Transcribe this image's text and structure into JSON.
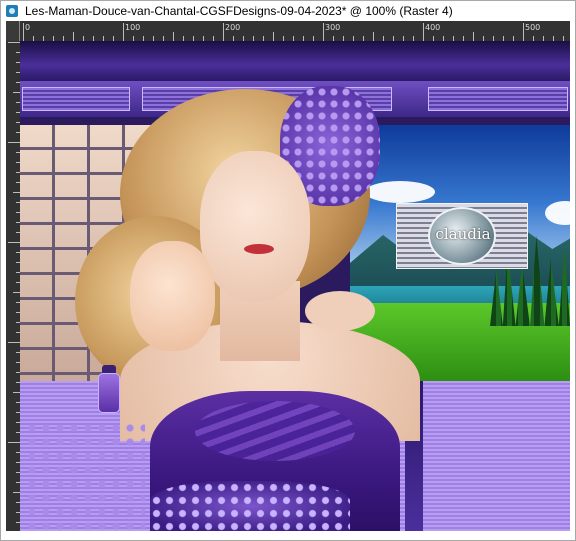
{
  "window": {
    "title": "Les-Maman-Douce-van-Chantal-CGSFDesigns-09-04-2023* @ 100% (Raster 4)",
    "zoom": "100%",
    "layer": "Raster 4"
  },
  "ruler": {
    "labels": [
      "0",
      "100",
      "200",
      "300",
      "400",
      "500"
    ]
  },
  "watermark": {
    "name": "claudia"
  },
  "colors": {
    "canvas_accent": "#4b2f99",
    "floor": "#b99df3",
    "dress": "#3b1880"
  }
}
